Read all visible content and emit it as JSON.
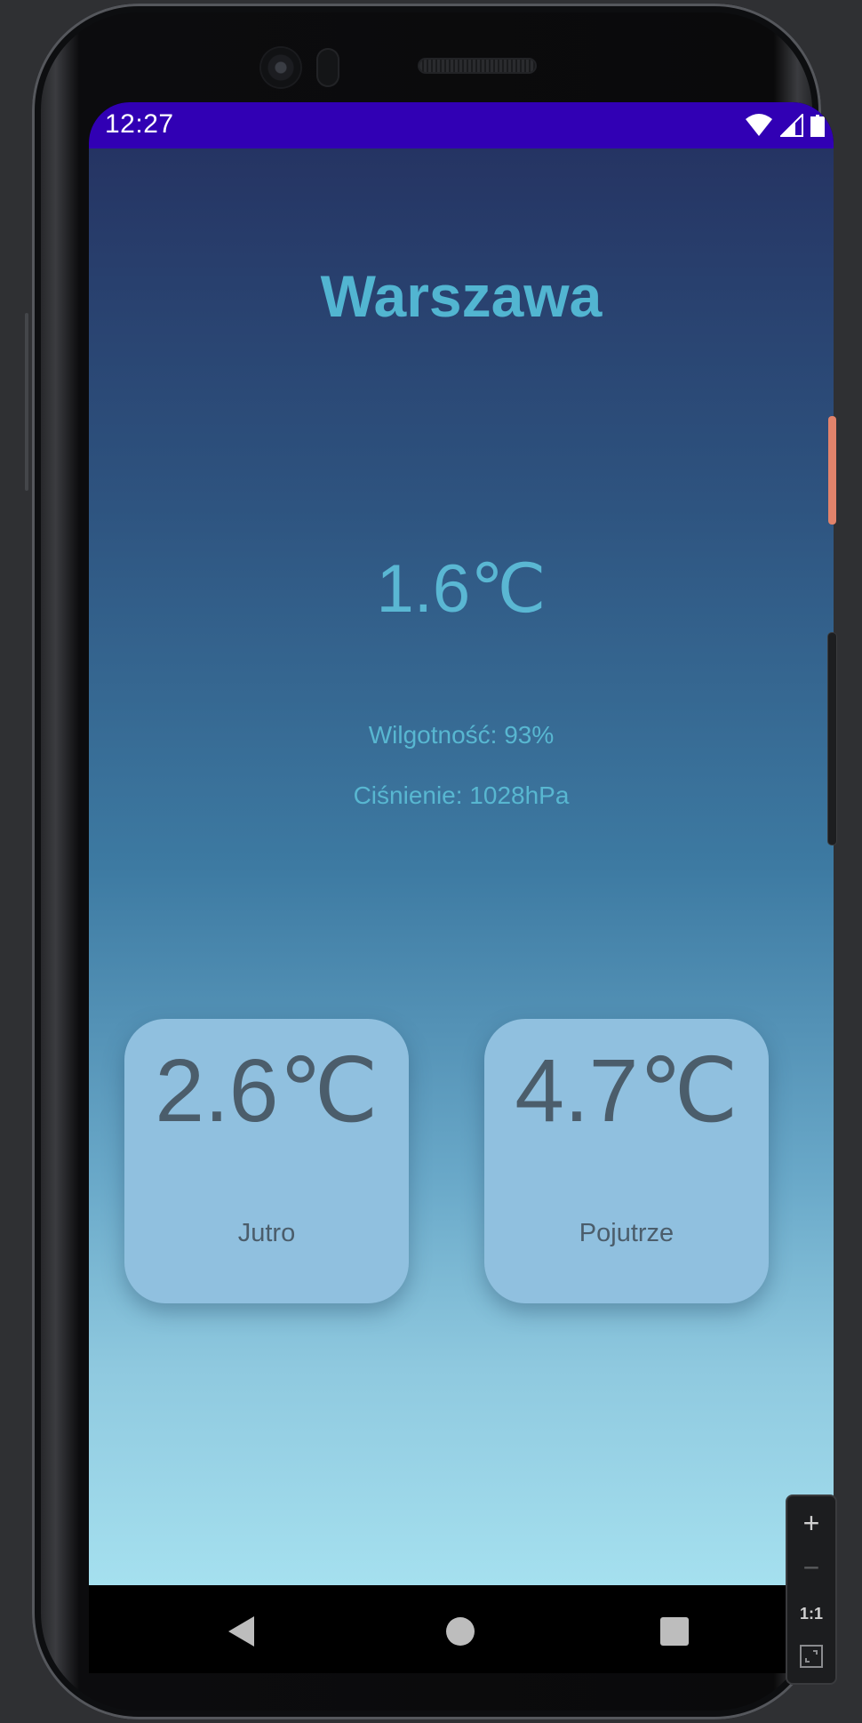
{
  "status_bar": {
    "time": "12:27",
    "icons": [
      "wifi-icon",
      "signal-icon",
      "battery-icon"
    ],
    "background": "#3100b4"
  },
  "weather": {
    "city": "Warszawa",
    "current_temp": "1.6℃",
    "humidity": "Wilgotność: 93%",
    "pressure": "Ciśnienie: 1028hPa"
  },
  "forecast": [
    {
      "temp": "2.6℃",
      "label": "Jutro"
    },
    {
      "temp": "4.7℃",
      "label": "Pojutrze"
    }
  ],
  "navigation": {
    "buttons": [
      "back-icon",
      "home-icon",
      "recents-icon"
    ]
  },
  "emulator_zoom": {
    "plus": "+",
    "minus": "−",
    "one_to_one": "1:1"
  },
  "colors": {
    "accent": "#52b5d1",
    "card": "#90c0df",
    "card_text": "#4b5d6b",
    "gradient_top": "#253463",
    "gradient_bottom": "#a5e0ef"
  }
}
